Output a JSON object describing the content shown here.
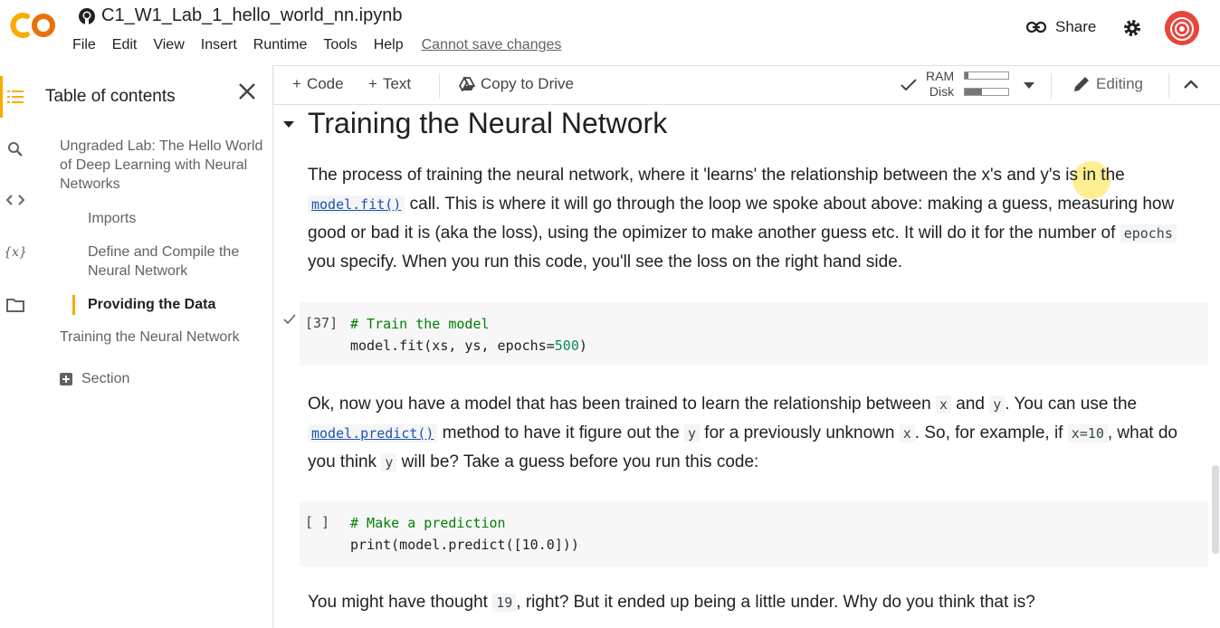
{
  "app": {
    "notebook_title": "C1_W1_Lab_1_hello_world_nn.ipynb",
    "logo_text": "CO",
    "menu": [
      "File",
      "Edit",
      "View",
      "Insert",
      "Runtime",
      "Tools",
      "Help"
    ],
    "save_status": "Cannot save changes",
    "share_label": "Share"
  },
  "colors": {
    "logo_orange": "#f9ab00",
    "active_marker": "#f9ab00",
    "link_blue": "#1a55b0",
    "comment_green": "#008000",
    "number_green": "#09885a"
  },
  "toolbar": {
    "code_label": "Code",
    "text_label": "Text",
    "copy_label": "Copy to Drive",
    "ram_label": "RAM",
    "disk_label": "Disk",
    "ram_usage": 0.08,
    "disk_usage": 0.4,
    "editing_label": "Editing"
  },
  "sidebar": {
    "title": "Table of contents",
    "items": [
      {
        "label": "Ungraded Lab: The Hello World of Deep Learning with Neural Networks",
        "level": 1
      },
      {
        "label": "Imports",
        "level": 2
      },
      {
        "label": "Define and Compile the Neural Network",
        "level": 2
      },
      {
        "label": "Providing the Data",
        "level": 2,
        "active": true
      },
      {
        "label": "Training the Neural Network",
        "level": 1
      }
    ],
    "section_label": "Section"
  },
  "rail_icons": [
    "toc-icon",
    "search-icon",
    "code-snippets-icon",
    "variables-icon",
    "files-icon"
  ],
  "content": {
    "heading": "Training the Neural Network",
    "para1": {
      "t1": "The process of training the neural network, where it 'learns' the relationship between the x's and y's is in the",
      "code1": "model.fit()",
      "t2": " call. This is where it will go through the loop we spoke about above: making a guess, measuring how good or bad it is (aka the loss), using the opimizer to make another guess etc. It will do it for the number of ",
      "code2": "epochs",
      "t3": " you specify. When you run this code, you'll see the loss on the right hand side."
    },
    "cell1": {
      "exec_count": "[37]",
      "comment": "# Train the model",
      "code_prefix": "model.fit(xs, ys, epochs=",
      "code_num": "500",
      "code_suffix": ")"
    },
    "para2": {
      "t1": "Ok, now you have a model that has been trained to learn the relationship between ",
      "c1": "x",
      "t2": " and ",
      "c2": "y",
      "t3": ". You can use the ",
      "code1": "model.predict()",
      "t4": " method to have it figure out the ",
      "c3": "y",
      "t5": " for a previously unknown ",
      "c4": "x",
      "t6": ". So, for example, if ",
      "c5": "x=10",
      "t7": ", what do you think ",
      "c6": "y",
      "t8": " will be? Take a guess before you run this code:"
    },
    "cell2": {
      "exec_count": "[ ]",
      "comment": "# Make a prediction",
      "code": "print(model.predict([10.0]))"
    },
    "para3": {
      "t1": "You might have thought ",
      "c1": "19",
      "t2": ", right? But it ended up being a little under. Why do you think that is?"
    }
  }
}
